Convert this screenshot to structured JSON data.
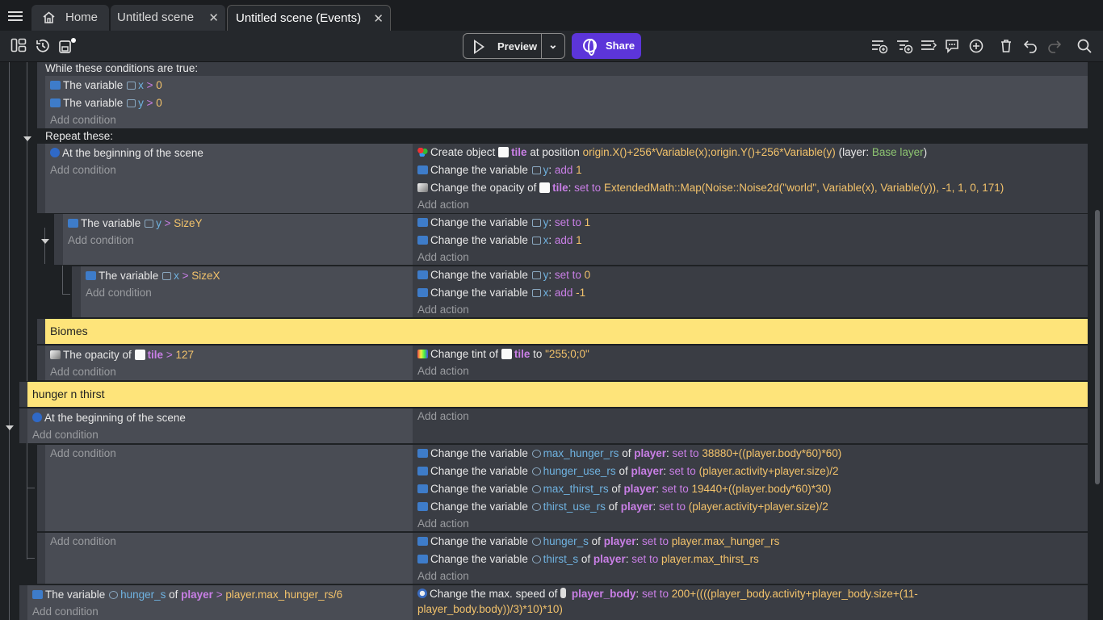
{
  "tabs": [
    {
      "label": "Home"
    },
    {
      "label": "Untitled scene"
    },
    {
      "label": "Untitled scene (Events)"
    }
  ],
  "toolbar": {
    "preview_label": "Preview",
    "share_label": "Share",
    "accent": "#5c35d9"
  },
  "events": {
    "while_label": "While these conditions are true:",
    "repeat_label": "Repeat these:",
    "add_condition": "Add condition",
    "add_action": "Add action",
    "the_variable": "The variable",
    "change_variable": "Change the variable",
    "at_beginning": "At the beginning of the scene",
    "comment_biomes": "Biomes",
    "comment_hunger": "hunger n thirst",
    "while_cond_1": {
      "var": "x",
      "op": ">",
      "val": "0"
    },
    "while_cond_2": {
      "var": "y",
      "op": ">",
      "val": "0"
    },
    "create": {
      "prefix": "Create object",
      "obj": "tile",
      "mid": "at position",
      "expr": "origin.X()+256*Variable(x);origin.Y()+256*Variable(y)",
      "layer_pre": "(layer:",
      "layer": "Base layer",
      "layer_post": ")"
    },
    "a_y_add1": {
      "var": "y",
      "op": "add",
      "val": "1"
    },
    "opacity_action": {
      "prefix": "Change the opacity of",
      "obj": "tile",
      "op": "set to",
      "expr": "ExtendedMath::Map(Noise::Noise2d(\"world\", Variable(x), Variable(y)), -1, 1, 0, 171)"
    },
    "c_y_sizey": {
      "var": "y",
      "op": ">",
      "val": "SizeY"
    },
    "a_y_set1": {
      "var": "y",
      "op": "set to",
      "val": "1"
    },
    "a_x_add1": {
      "var": "x",
      "op": "add",
      "val": "1"
    },
    "c_x_sizex": {
      "var": "x",
      "op": ">",
      "val": "SizeX"
    },
    "a_y_set0": {
      "var": "y",
      "op": "set to",
      "val": "0"
    },
    "a_x_addm1": {
      "var": "x",
      "op": "add",
      "val": "-1"
    },
    "opacity_cond": {
      "prefix": "The opacity of",
      "obj": "tile",
      "op": ">",
      "val": "127"
    },
    "tint": {
      "prefix": "Change tint of",
      "obj": "tile",
      "mid": "to",
      "val": "\"255;0;0\""
    },
    "of_word": "of",
    "player": "player",
    "hunger_actions": [
      {
        "var": "max_hunger_rs",
        "op": "set to",
        "val": "38880+((player.body*60)*60)"
      },
      {
        "var": "hunger_use_rs",
        "op": "set to",
        "val": "(player.activity+player.size)/2"
      },
      {
        "var": "max_thirst_rs",
        "op": "set to",
        "val": "19440+((player.body*60)*30)"
      },
      {
        "var": "thirst_use_rs",
        "op": "set to",
        "val": "(player.activity+player.size)/2"
      }
    ],
    "reset_actions": [
      {
        "var": "hunger_s",
        "op": "set to",
        "val": "player.max_hunger_rs"
      },
      {
        "var": "thirst_s",
        "op": "set to",
        "val": "player.max_thirst_rs"
      }
    ],
    "last_cond": {
      "var": "hunger_s",
      "op": ">",
      "val": "player.max_hunger_rs/6"
    },
    "speed": {
      "prefix": "Change the max. speed of",
      "obj": "player_body",
      "op": "set to",
      "expr1": "200+((((player_body.activity+player_body.size+(11-",
      "expr2": "player_body.body))/3)*10)*10)"
    }
  }
}
